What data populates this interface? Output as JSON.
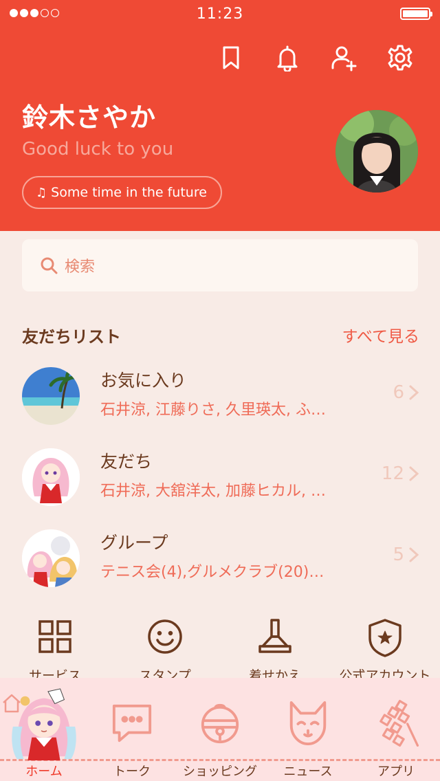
{
  "status_bar": {
    "time": "11:23"
  },
  "profile": {
    "name": "鈴木さやか",
    "status_message": "Good luck to you",
    "music": "Some time in the future"
  },
  "top_icons": [
    "bookmark-icon",
    "bell-icon",
    "add-friend-icon",
    "gear-icon"
  ],
  "search": {
    "placeholder": "検索"
  },
  "friends": {
    "title": "友だちリスト",
    "see_all": "すべて見る",
    "rows": [
      {
        "name": "お気に入り",
        "members": "石井涼, 江藤りさ, 久里瑛太, ふ…",
        "count": "6"
      },
      {
        "name": "友だち",
        "members": "石井涼, 大舘洋太, 加藤ヒカル, …",
        "count": "12"
      },
      {
        "name": "グループ",
        "members": "テニス会(4),グルメクラブ(20)…",
        "count": "5"
      }
    ]
  },
  "services": [
    {
      "label": "サービス",
      "icon": "grid-icon"
    },
    {
      "label": "スタンプ",
      "icon": "smiley-icon"
    },
    {
      "label": "着せかえ",
      "icon": "brush-icon"
    },
    {
      "label": "公式アカウント",
      "icon": "shield-star-icon"
    }
  ],
  "tabs": [
    {
      "label": "ホーム",
      "icon": "home-icon",
      "active": true
    },
    {
      "label": "トーク",
      "icon": "chat-bubble-icon"
    },
    {
      "label": "ショッピング",
      "icon": "bell-ball-icon"
    },
    {
      "label": "ニュース",
      "icon": "fox-mask-icon"
    },
    {
      "label": "アプリ",
      "icon": "paper-streamer-icon"
    }
  ],
  "colors": {
    "brand": "#ef4a35",
    "background": "#f8ebe6",
    "text_brown": "#6b3a1f",
    "tab_bg": "#fde2e2"
  }
}
